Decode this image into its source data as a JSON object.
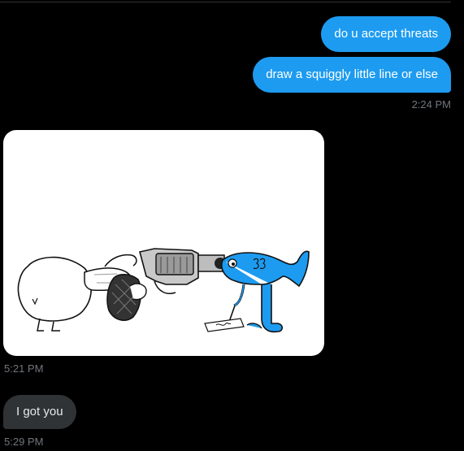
{
  "conversation": {
    "messages": [
      {
        "direction": "sent",
        "text": "do u accept threats"
      },
      {
        "direction": "sent",
        "text": "draw a squiggly little line or else"
      },
      {
        "direction": "received",
        "kind": "image",
        "image_description": "cartoon drawing"
      },
      {
        "direction": "received",
        "text": "I got you"
      }
    ],
    "timestamps": [
      "2:24 PM",
      "5:21 PM",
      "5:29 PM"
    ]
  },
  "colors": {
    "background": "#000000",
    "sent_bubble": "#1d9bf0",
    "received_bubble": "#2f3336",
    "timestamp": "#71767b",
    "fish": "#1d9bf0"
  }
}
